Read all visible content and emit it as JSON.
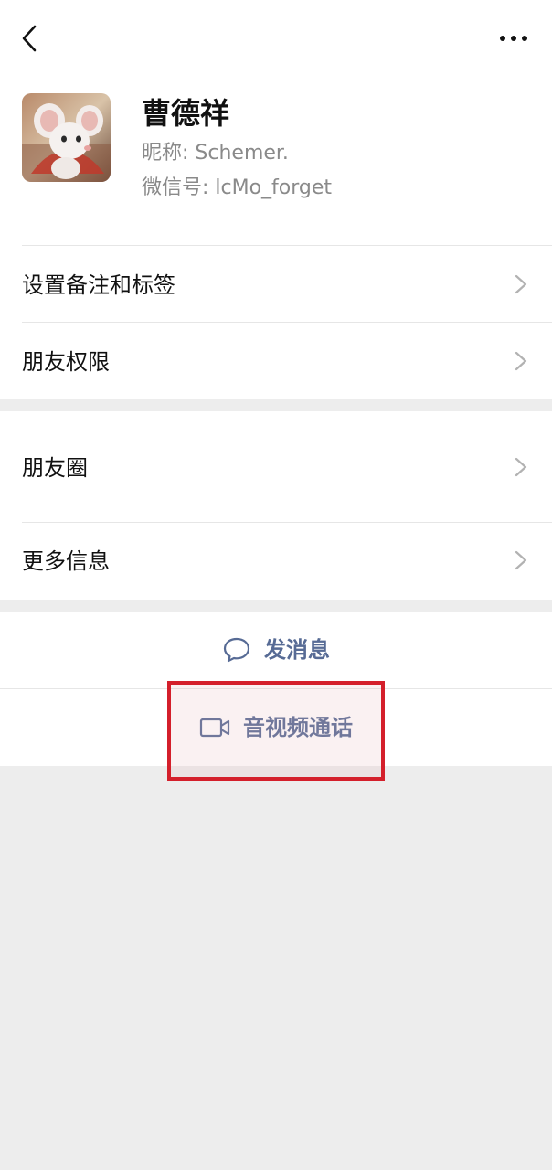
{
  "profile": {
    "name": "曹德祥",
    "nickname_line": "昵称:  Schemer.",
    "wechat_id_line": "微信号:  lcMo_forget",
    "avatar_icon": "mouse-avatar-icon"
  },
  "menu_group1": [
    {
      "label": "设置备注和标签"
    },
    {
      "label": "朋友权限"
    }
  ],
  "menu_group2": [
    {
      "label": "朋友圈"
    },
    {
      "label": "更多信息"
    }
  ],
  "actions": {
    "send_message": "发消息",
    "video_call": "音视频通话"
  },
  "colors": {
    "accent": "#576b95",
    "highlight": "#d41f2b",
    "background": "#ededed"
  }
}
